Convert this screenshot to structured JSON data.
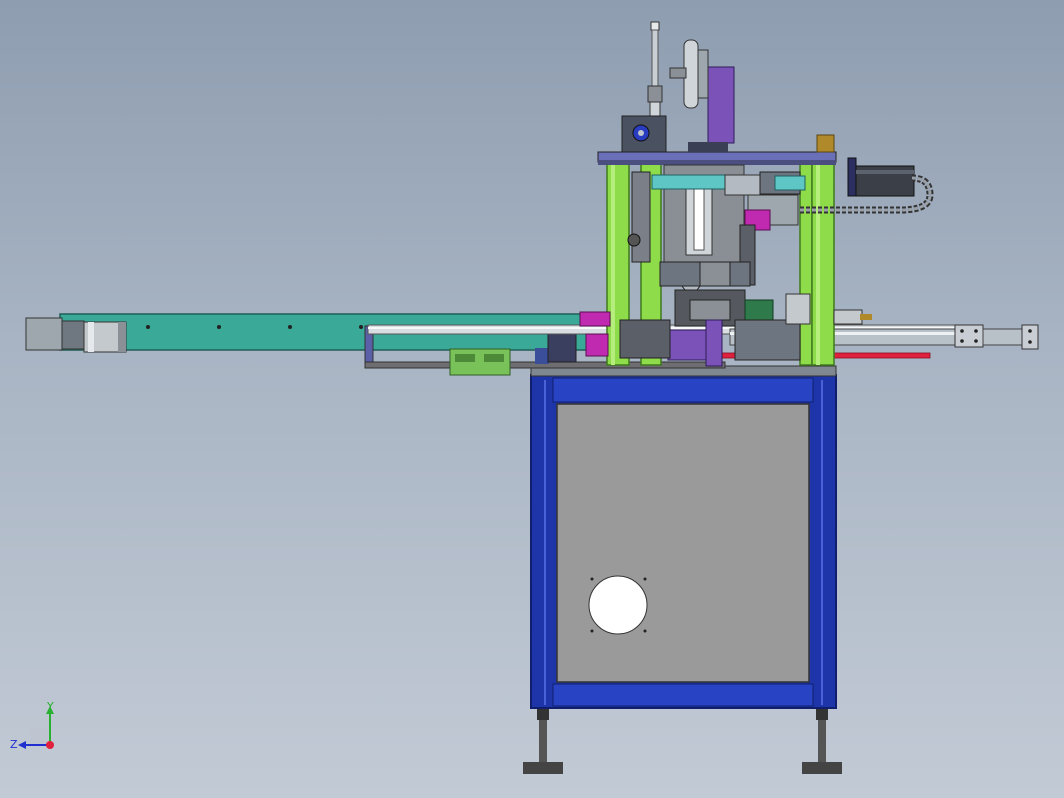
{
  "viewport": {
    "background_top": "#8e9db0",
    "background_bottom": "#c2cad5"
  },
  "colors": {
    "frame_blue": "#1d35a8",
    "frame_blue_dark": "#0f1f6e",
    "panel_grey": "#9a9a9a",
    "column_green": "#8fdc4a",
    "conveyor_teal": "#3aa998",
    "plate_purple": "#7a52b8",
    "motor_grey": "#9ea7ae",
    "accent_magenta": "#c02ab0",
    "red_rod": "#e0203c",
    "brass": "#b08a2a"
  },
  "triad": {
    "x_axis_color": "#e0203c",
    "y_axis_color": "#28b030",
    "z_axis_color": "#2030d0",
    "y_label": "Y",
    "z_label": "Z"
  }
}
